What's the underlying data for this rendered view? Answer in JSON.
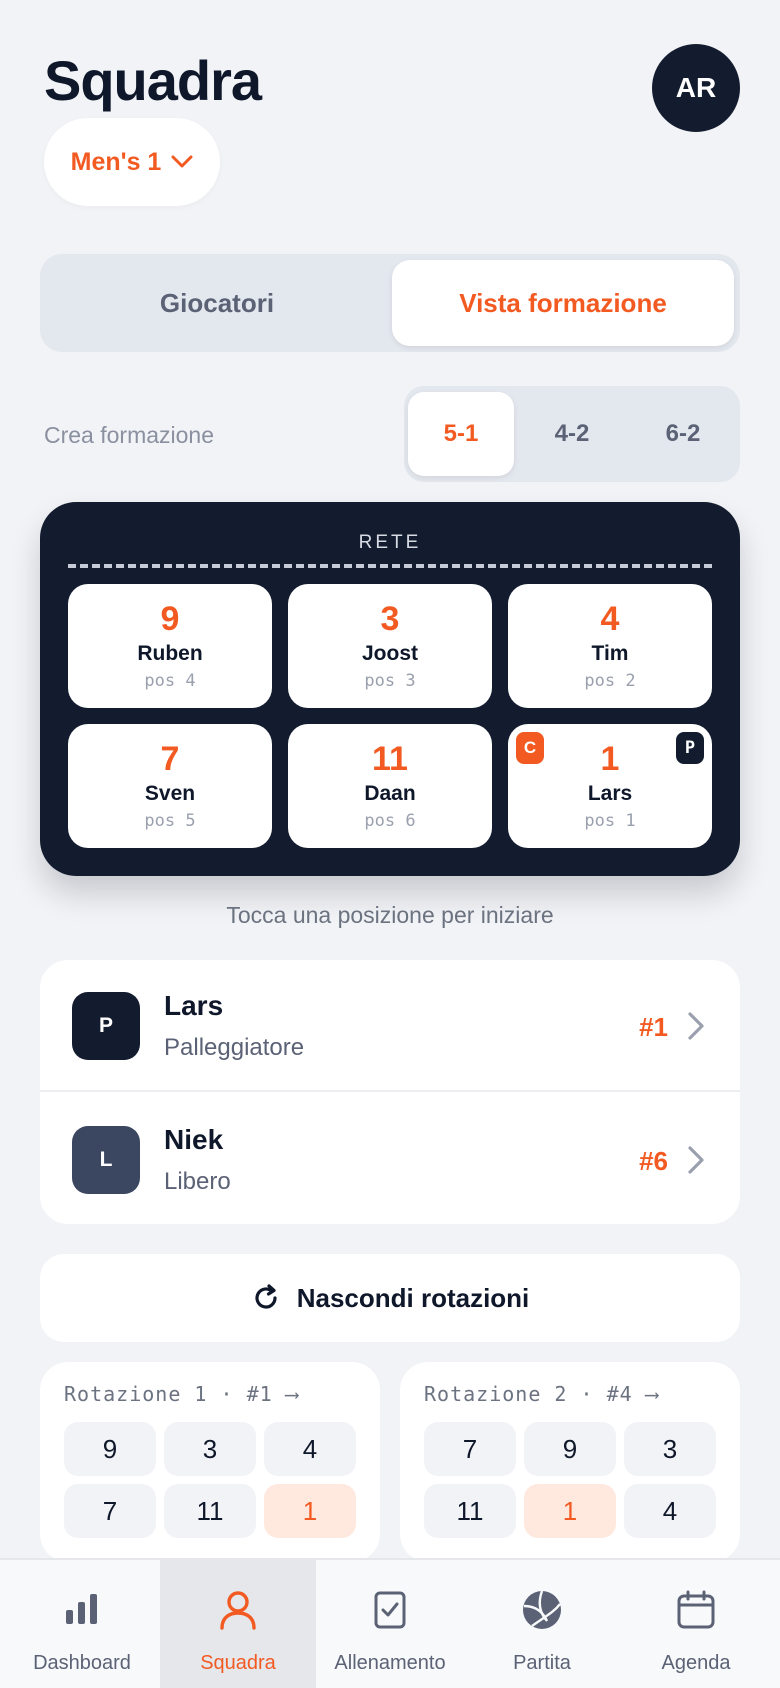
{
  "header": {
    "title": "Squadra",
    "avatar_initials": "AR",
    "team": "Men's 1"
  },
  "view_toggle": {
    "players": "Giocatori",
    "formation_view": "Vista formazione",
    "active": "formation_view"
  },
  "formation": {
    "label": "Crea formazione",
    "schemes": [
      "5-1",
      "4-2",
      "6-2"
    ],
    "selected": "5-1"
  },
  "court": {
    "net_label": "RETE",
    "front_row": [
      {
        "number": "9",
        "name": "Ruben",
        "pos": "pos 4"
      },
      {
        "number": "3",
        "name": "Joost",
        "pos": "pos 3"
      },
      {
        "number": "4",
        "name": "Tim",
        "pos": "pos 2"
      }
    ],
    "back_row": [
      {
        "number": "7",
        "name": "Sven",
        "pos": "pos 5"
      },
      {
        "number": "11",
        "name": "Daan",
        "pos": "pos 6"
      },
      {
        "number": "1",
        "name": "Lars",
        "pos": "pos 1",
        "captain_badge": "C",
        "setter_badge": "P"
      }
    ]
  },
  "hint": "Tocca una posizione per iniziare",
  "players": [
    {
      "initial": "P",
      "name": "Lars",
      "role": "Palleggiatore",
      "number": "#1",
      "color": "#131c2e"
    },
    {
      "initial": "L",
      "name": "Niek",
      "role": "Libero",
      "number": "#6",
      "color": "#3b4760"
    }
  ],
  "rotation_button": "Nascondi rotazioni",
  "rotations": [
    {
      "title": "Rotazione 1 · #1 ⟶",
      "cells": [
        "9",
        "3",
        "4",
        "7",
        "11",
        "1"
      ],
      "highlight": 5
    },
    {
      "title": "Rotazione 2 · #4 ⟶",
      "cells": [
        "7",
        "9",
        "3",
        "11",
        "1",
        "4"
      ],
      "highlight": 4
    }
  ],
  "tabs": [
    {
      "label": "Dashboard",
      "icon": "bar-chart-icon"
    },
    {
      "label": "Squadra",
      "icon": "user-icon",
      "active": true
    },
    {
      "label": "Allenamento",
      "icon": "clipboard-check-icon"
    },
    {
      "label": "Partita",
      "icon": "volleyball-icon"
    },
    {
      "label": "Agenda",
      "icon": "calendar-icon"
    }
  ],
  "colors": {
    "accent": "#f25a22",
    "dark": "#131c2e",
    "background": "#f2f3f6"
  }
}
